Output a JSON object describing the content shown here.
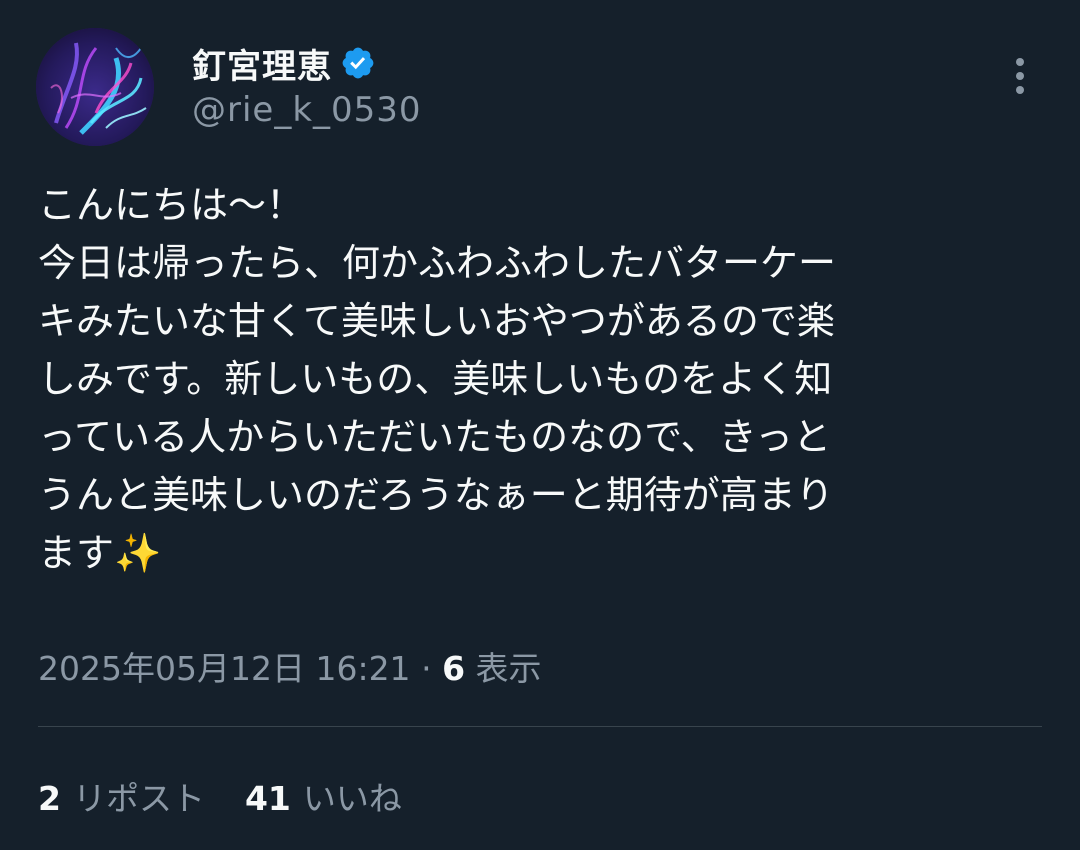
{
  "author": {
    "display_name": "釘宮理恵",
    "handle": "@rie_k_0530",
    "verified": true,
    "avatar_icon": "avatar-neon-light-art"
  },
  "tweet": {
    "lines": [
      "こんにちは〜！",
      "今日は帰ったら、何かふわふわしたバターケー",
      "キみたいな甘くて美味しいおやつがあるので楽",
      "しみです。新しいもの、美味しいものをよく知",
      "っている人からいただいたものなので、きっと",
      "うんと美味しいのだろうなぁーと期待が高まり",
      "ます✨"
    ]
  },
  "meta": {
    "timestamp": "2025年05月12日 16:21",
    "separator": "·",
    "views_count": "6",
    "views_label": "表示"
  },
  "stats": {
    "reposts_count": "2",
    "reposts_label": "リポスト",
    "likes_count": "41",
    "likes_label": "いいね"
  },
  "colors": {
    "background": "#15202b",
    "primary_text": "#f7f9f9",
    "secondary_text": "#8b98a5",
    "verified_badge": "#1d9bf0",
    "divider": "#38444d"
  }
}
